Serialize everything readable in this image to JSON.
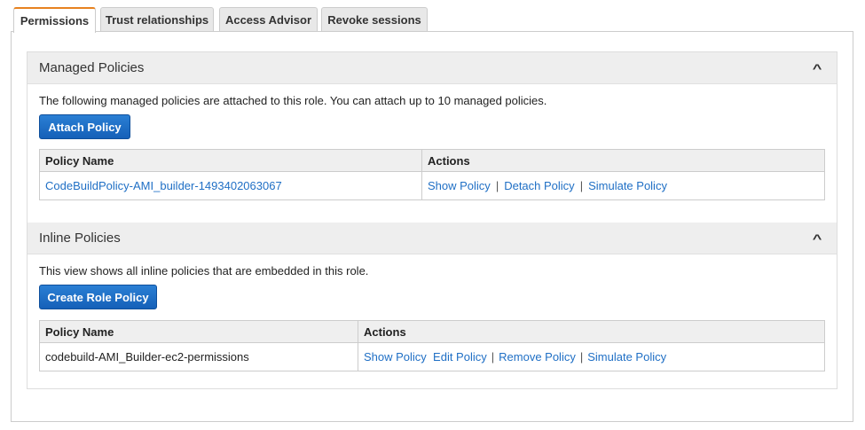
{
  "tabs": [
    {
      "label": "Permissions",
      "active": true
    },
    {
      "label": "Trust relationships"
    },
    {
      "label": "Access Advisor"
    },
    {
      "label": "Revoke sessions"
    }
  ],
  "managed": {
    "title": "Managed Policies",
    "description": "The following managed policies are attached to this role. You can attach up to 10 managed policies.",
    "button": "Attach Policy",
    "columns": [
      "Policy Name",
      "Actions"
    ],
    "rows": [
      {
        "name": "CodeBuildPolicy-AMI_builder-1493402063067",
        "actions": [
          "Show Policy",
          "Detach Policy",
          "Simulate Policy"
        ]
      }
    ]
  },
  "inline": {
    "title": "Inline Policies",
    "description": "This view shows all inline policies that are embedded in this role.",
    "button": "Create Role Policy",
    "columns": [
      "Policy Name",
      "Actions"
    ],
    "rows": [
      {
        "name": "codebuild-AMI_Builder-ec2-permissions",
        "actions": [
          "Show Policy",
          "Edit Policy",
          "Remove Policy",
          "Simulate Policy"
        ]
      }
    ]
  },
  "icons": {
    "collapse": "chevron-up-icon"
  },
  "colors": {
    "accent": "#e7821f",
    "link": "#1f6fc5",
    "button": "#1a6bc6"
  }
}
